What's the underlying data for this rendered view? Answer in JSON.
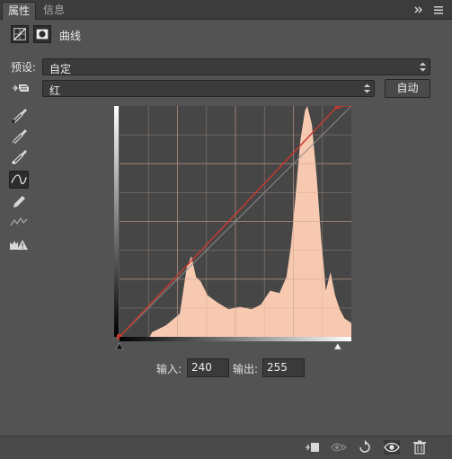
{
  "tabs": [
    {
      "label": "属性",
      "active": true
    },
    {
      "label": "信息",
      "active": false
    }
  ],
  "panel": {
    "title": "曲线"
  },
  "preset": {
    "label": "预设:",
    "value": "自定"
  },
  "channel": {
    "value": "红",
    "auto_label": "自动"
  },
  "curve": {
    "input_label": "输入:",
    "input_value": "240",
    "output_label": "输出:",
    "output_value": "255",
    "range": [
      0,
      255
    ],
    "points": [
      [
        0,
        0
      ],
      [
        240,
        255
      ]
    ]
  },
  "icons": {
    "tools": [
      "eyedropper-black-icon",
      "eyedropper-gray-icon",
      "eyedropper-white-icon",
      "curve-edit-icon",
      "pencil-icon",
      "smooth-icon",
      "clipping-warning-icon"
    ],
    "bottom": [
      "clip-to-layer-icon",
      "view-previous-icon",
      "reset-icon",
      "visibility-icon",
      "delete-icon"
    ]
  },
  "colors": {
    "histogram": "#f7c9b0",
    "curve": "#c43a2e",
    "baseline": "#8a8a8a",
    "panel": "#535353"
  }
}
